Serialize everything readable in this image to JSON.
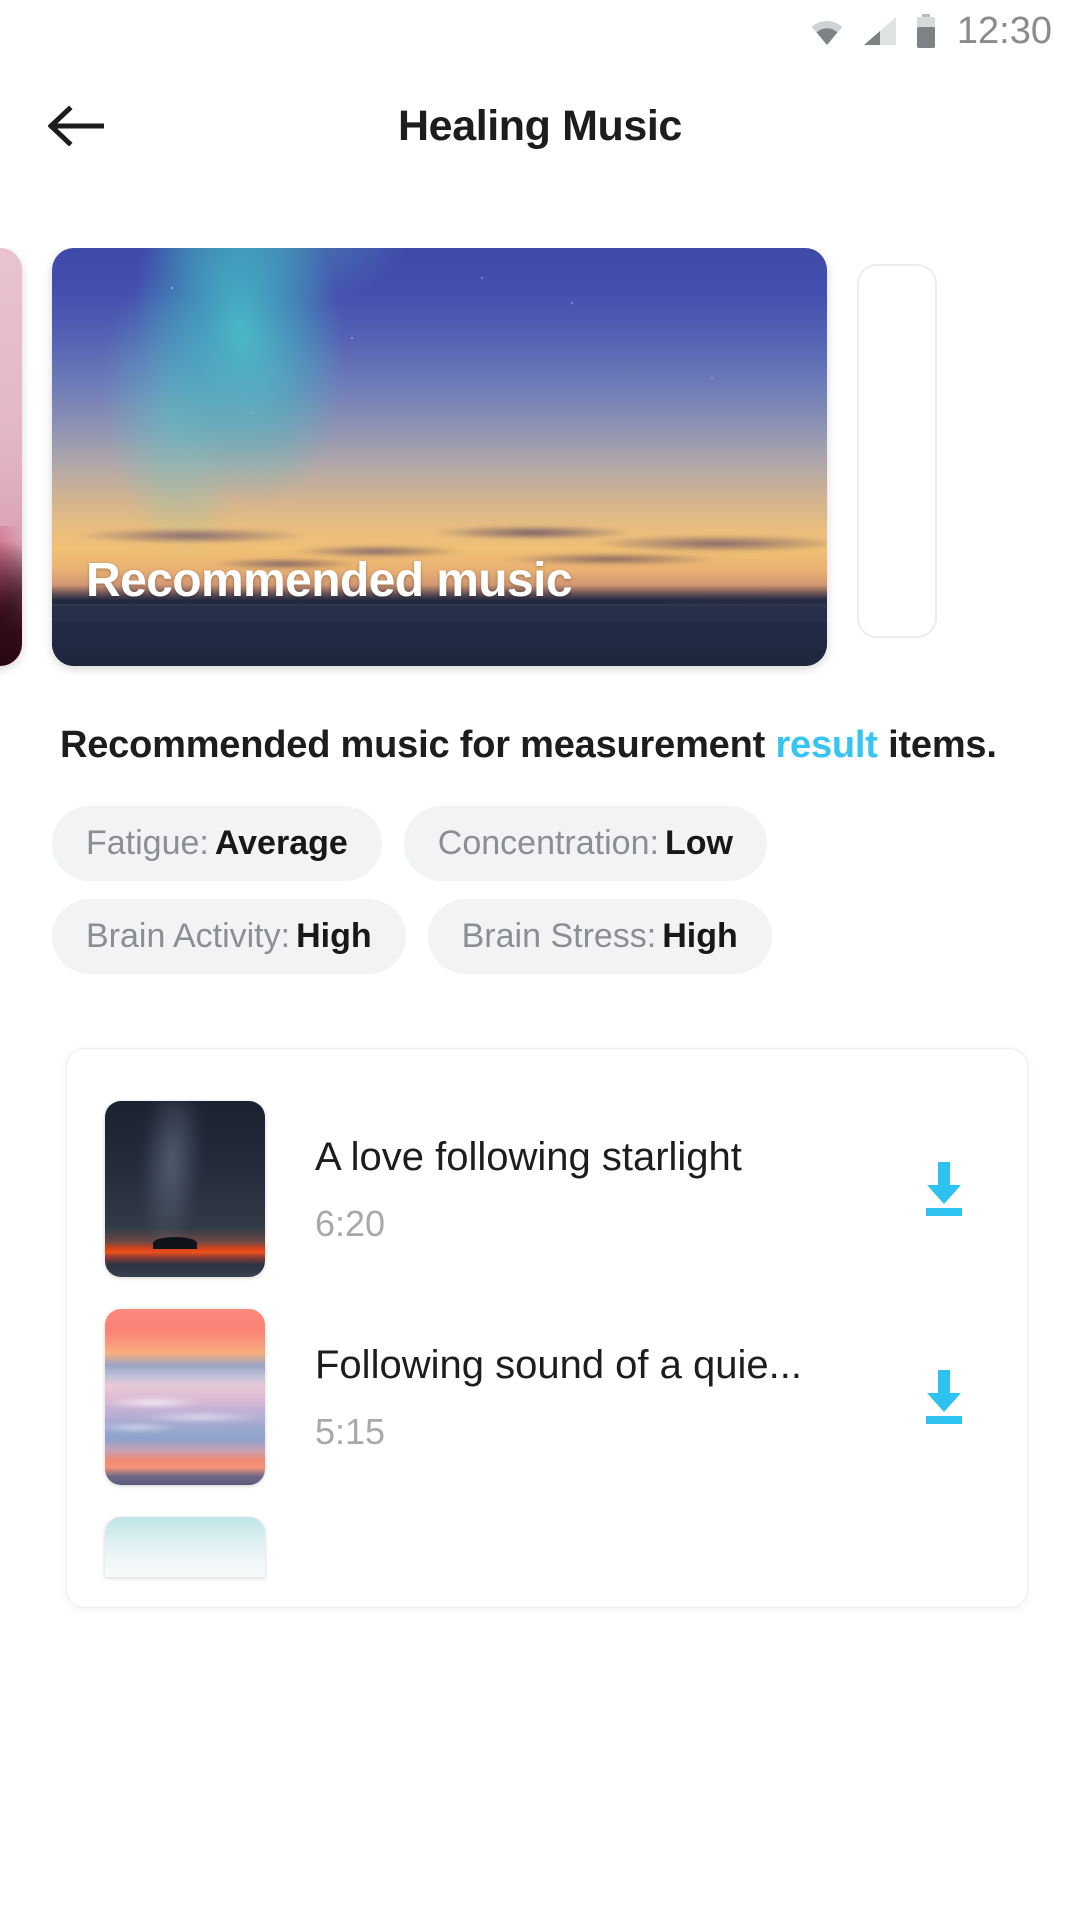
{
  "status_bar": {
    "time": "12:30",
    "icons": [
      "wifi-icon",
      "cellular-signal-icon",
      "battery-icon"
    ]
  },
  "app_bar": {
    "back_label": "←",
    "title": "Healing Music"
  },
  "carousel": {
    "active_card": {
      "caption": "Recommended music",
      "image": "aurora-sunset-ocean"
    },
    "prev_card": {
      "image": "pink-floral-sunset"
    },
    "next_card": {
      "image": "empty-placeholder"
    }
  },
  "description": {
    "before": " Recommended music for measurement ",
    "accent": "result",
    "after": " items."
  },
  "result_chips": [
    {
      "label": "Fatigue:",
      "value": "Average"
    },
    {
      "label": "Concentration:",
      "value": "Low"
    },
    {
      "label": "Brain Activity:",
      "value": "High"
    },
    {
      "label": "Brain Stress:",
      "value": "High"
    }
  ],
  "music_list": [
    {
      "title": "A love following starlight",
      "duration": "6:20",
      "thumbnail": "night-sky-milky-way",
      "action": "download-icon"
    },
    {
      "title": "Following sound of a quie...",
      "duration": "5:15",
      "thumbnail": "pink-sunset-beach",
      "action": "download-icon"
    },
    {
      "title": "",
      "duration": "",
      "thumbnail": "teal-gradient",
      "action": "download-icon"
    }
  ],
  "colors": {
    "accent": "#36c4f0",
    "download": "#2ec2f0",
    "chip_bg": "#f2f3f5",
    "chip_label": "#8b8e93",
    "chip_value": "#17181a",
    "title": "#1d1d1f",
    "duration": "#a9a9ac"
  }
}
